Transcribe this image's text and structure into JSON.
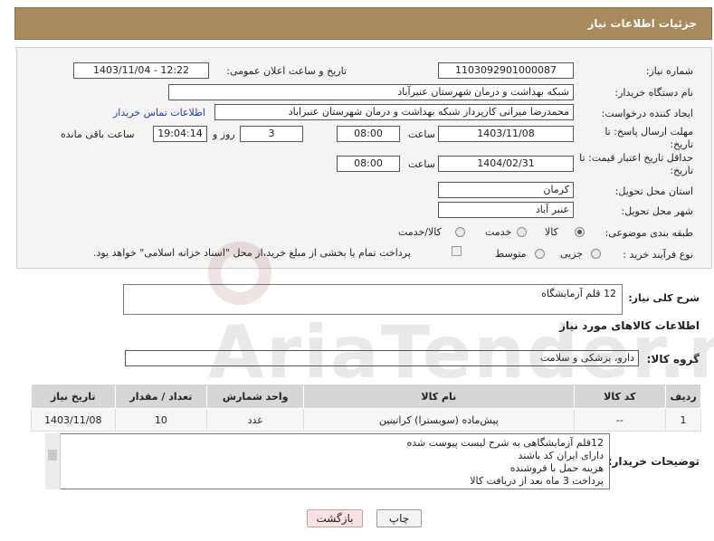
{
  "header": {
    "title": "جزئیات اطلاعات نیاز"
  },
  "form": {
    "need_number": {
      "label": "شماره نیاز:",
      "value": "1103092901000087"
    },
    "announce": {
      "label": "تاریخ و ساعت اعلان عمومی:",
      "value": "1403/11/04 - 12:22"
    },
    "buyer_org": {
      "label": "نام دستگاه خریدار:",
      "value": "شبکه بهداشت و درمان شهرستان عنبرآباد"
    },
    "creator": {
      "label": "ایجاد کننده درخواست:",
      "value": "محمدرضا میرانی کارپرداز  شبکه بهداشت و درمان شهرستان عنبراباد",
      "contact_link": "اطلاعات تماس خریدار"
    },
    "reply_deadline": {
      "label": "مهلت ارسال پاسخ: تا تاریخ:",
      "date": "1403/11/08",
      "time_label": "ساعت",
      "time": "08:00",
      "days": "3",
      "days_label": "روز و",
      "remaining": "19:04:14",
      "remaining_label": "ساعت باقی مانده"
    },
    "price_validity": {
      "label": "حداقل تاریخ اعتبار قیمت: تا تاریخ:",
      "date": "1404/02/31",
      "time_label": "ساعت",
      "time": "08:00"
    },
    "province": {
      "label": "استان محل تحویل:",
      "value": "کرمان"
    },
    "city": {
      "label": "شهر محل تحویل:",
      "value": "عنبر آباد"
    },
    "category": {
      "label": "طبقه بندی موضوعی:",
      "options": [
        "کالا",
        "خدمت",
        "کالا/خدمت"
      ]
    },
    "process": {
      "label": "نوع فرآیند خرید :",
      "options": [
        "جزیی",
        "متوسط"
      ],
      "payment_note": "پرداخت تمام یا بخشی از مبلغ خرید،از محل \"اسناد خزانه اسلامی\" خواهد بود."
    }
  },
  "summary": {
    "label": "شرح کلی نیاز:",
    "value": "12 قلم آزمایشگاه"
  },
  "goods_section": {
    "title": "اطلاعات کالاهای مورد نیاز",
    "group_label": "گروه کالا:",
    "group_value": "دارو، پزشکی و سلامت"
  },
  "table": {
    "headers": [
      "ردیف",
      "کد کالا",
      "نام کالا",
      "واحد شمارش",
      "تعداد / مقدار",
      "تاریخ نیاز"
    ],
    "rows": [
      [
        "1",
        "--",
        "پیش‌ماده (سوبسترا) کراتینین",
        "عدد",
        "10",
        "1403/11/08"
      ]
    ]
  },
  "buyer_notes": {
    "label": "توضیحات خریدار:",
    "lines": [
      "12قلم آزمایشگاهی به شرح لیست پیوست شده",
      "دارای ایران کد باشند",
      "هزینه حمل با فروشنده",
      "پرداخت 3 ماه بعد از دریافت کالا"
    ]
  },
  "buttons": {
    "print": "چاپ",
    "back": "بازگشت"
  },
  "watermark": "AriaTender.neT"
}
